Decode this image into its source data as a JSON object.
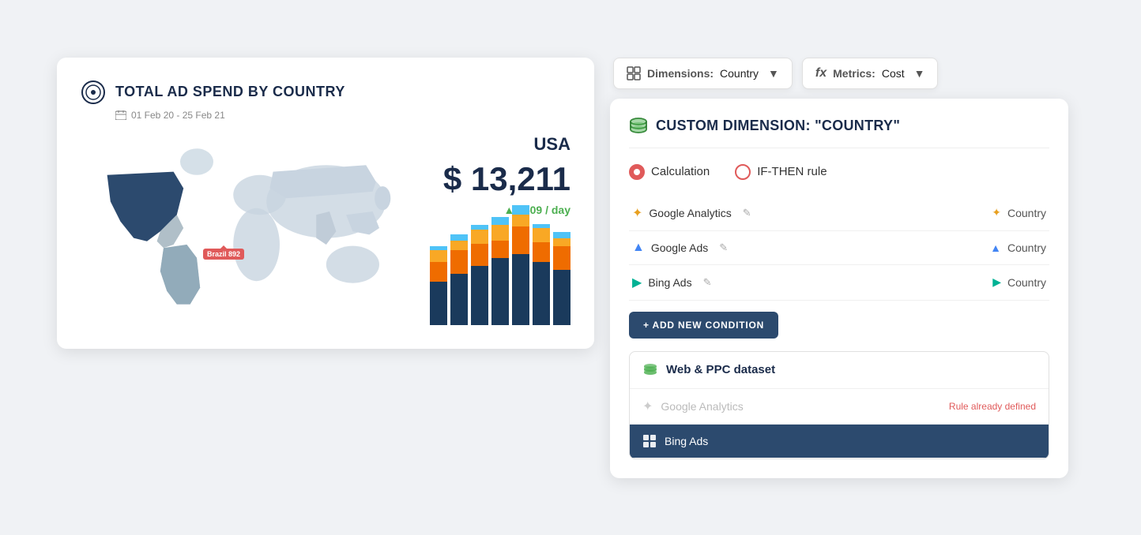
{
  "leftCard": {
    "title": "TOTAL AD SPEND BY COUNTRY",
    "dateRange": "01 Feb 20 - 25 Feb 21",
    "country": "USA",
    "value": "$ 13,211",
    "dailyChange": "▲ $509 / day",
    "brazilLabel": "Brazil 892"
  },
  "topBar": {
    "dimensionsLabel": "Dimensions:",
    "dimensionsValue": "Country",
    "metricsLabel": "Metrics:",
    "metricsValue": "Cost"
  },
  "panel": {
    "title": "CUSTOM DIMENSION: \"COUNTRY\"",
    "radioOptions": [
      {
        "label": "Calculation",
        "selected": true
      },
      {
        "label": "IF-THEN rule",
        "selected": false
      }
    ],
    "sources": [
      {
        "icon": "ga",
        "name": "Google Analytics",
        "field": "Country"
      },
      {
        "icon": "gads",
        "name": "Google Ads",
        "field": "Country"
      },
      {
        "icon": "bing",
        "name": "Bing Ads",
        "field": "Country"
      }
    ],
    "addConditionBtn": "+ ADD NEW CONDITION",
    "datasetLabel": "Web & PPC dataset",
    "datasetItems": [
      {
        "icon": "ga",
        "name": "Google Analytics",
        "status": "Rule already defined",
        "disabled": true,
        "active": false
      },
      {
        "icon": "bing",
        "name": "Bing Ads",
        "status": "",
        "disabled": false,
        "active": true
      }
    ]
  },
  "barChart": {
    "bars": [
      {
        "navy": 55,
        "orange": 25,
        "yellow": 15,
        "cyan": 5
      },
      {
        "navy": 65,
        "orange": 30,
        "yellow": 12,
        "cyan": 8
      },
      {
        "navy": 75,
        "orange": 28,
        "yellow": 18,
        "cyan": 6
      },
      {
        "navy": 85,
        "orange": 22,
        "yellow": 20,
        "cyan": 10
      },
      {
        "navy": 90,
        "orange": 35,
        "yellow": 15,
        "cyan": 12
      },
      {
        "navy": 80,
        "orange": 25,
        "yellow": 18,
        "cyan": 5
      },
      {
        "navy": 70,
        "orange": 30,
        "yellow": 10,
        "cyan": 8
      }
    ]
  }
}
